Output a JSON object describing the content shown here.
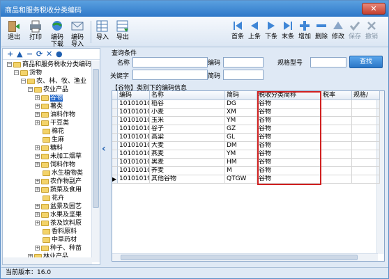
{
  "window": {
    "title": "商品和服务税收分类编码",
    "close": "✕"
  },
  "toolbar": {
    "exit": "退出",
    "print": "打印",
    "download": [
      "编码",
      "下载"
    ],
    "upload": [
      "编码",
      "导入"
    ],
    "import": "导入",
    "export": "导出",
    "first": "首条",
    "prev": "上条",
    "next": "下条",
    "last": "末条",
    "add": "增加",
    "delete": "删除",
    "edit": "修改",
    "save": "保存",
    "undo": "撤销"
  },
  "left_tools": [
    "+",
    "▲",
    "−",
    "⟳",
    "✕",
    "●"
  ],
  "tree": [
    {
      "label": "商品和服务税收分类编码",
      "indent": 0,
      "pm": "−"
    },
    {
      "label": "货物",
      "indent": 1,
      "pm": "−"
    },
    {
      "label": "农、林、牧、渔业",
      "indent": 2,
      "pm": "−"
    },
    {
      "label": "农业产品",
      "indent": 3,
      "pm": "−"
    },
    {
      "label": "谷物",
      "indent": 4,
      "pm": "+",
      "selected": true
    },
    {
      "label": "薯类",
      "indent": 4,
      "pm": "+"
    },
    {
      "label": "油料作物",
      "indent": 4,
      "pm": "+"
    },
    {
      "label": "干豆类",
      "indent": 4,
      "pm": "+"
    },
    {
      "label": "棉花",
      "indent": 4,
      "pm": ""
    },
    {
      "label": "生麻",
      "indent": 4,
      "pm": ""
    },
    {
      "label": "糖料",
      "indent": 4,
      "pm": "+"
    },
    {
      "label": "未加工烟草",
      "indent": 4,
      "pm": "+"
    },
    {
      "label": "饲料作物",
      "indent": 4,
      "pm": "+"
    },
    {
      "label": "水生植物类",
      "indent": 4,
      "pm": ""
    },
    {
      "label": "农作物副产",
      "indent": 4,
      "pm": "+"
    },
    {
      "label": "蔬菜及食用",
      "indent": 4,
      "pm": "+"
    },
    {
      "label": "花卉",
      "indent": 4,
      "pm": ""
    },
    {
      "label": "盆景及园艺",
      "indent": 4,
      "pm": "+"
    },
    {
      "label": "水果及坚果",
      "indent": 4,
      "pm": "+"
    },
    {
      "label": "茶及饮料原",
      "indent": 4,
      "pm": "+"
    },
    {
      "label": "香料原料",
      "indent": 4,
      "pm": ""
    },
    {
      "label": "中草药材",
      "indent": 4,
      "pm": ""
    },
    {
      "label": "种子、种苗",
      "indent": 4,
      "pm": "+"
    },
    {
      "label": "林业产品",
      "indent": 3,
      "pm": "+"
    }
  ],
  "query": {
    "title": "查询条件",
    "name_label": "名称",
    "code_label": "编码",
    "model_label": "规格型号",
    "keyword_label": "关键字",
    "short_code_label": "简码",
    "search": "查找"
  },
  "grid": {
    "title": "【谷物】类别下的编码信息",
    "headers": [
      "编码",
      "名称",
      "简码",
      "税收分类简称",
      "税率",
      "规格/"
    ],
    "rows": [
      [
        "1010101010(",
        "稻谷",
        "DG",
        "谷物"
      ],
      [
        "1010101020(",
        "小麦",
        "XM",
        "谷物"
      ],
      [
        "1010101030(",
        "玉米",
        "YM",
        "谷物"
      ],
      [
        "1010101040(",
        "谷子",
        "GZ",
        "谷物"
      ],
      [
        "1010101050(",
        "高粱",
        "GL",
        "谷物"
      ],
      [
        "1010101060(",
        "大麦",
        "DM",
        "谷物"
      ],
      [
        "1010101070(",
        "燕麦",
        "YM",
        "谷物"
      ],
      [
        "1010101080(",
        "黑麦",
        "HM",
        "谷物"
      ],
      [
        "1010101090(",
        "荞麦",
        "M",
        "谷物"
      ],
      [
        "1010101990(",
        "其他谷物",
        "QTGW",
        "谷物"
      ]
    ],
    "current_marker": "▶"
  },
  "status": {
    "version": "当前版本：16.0"
  },
  "colors": {
    "title": "#2f78c8",
    "accent": "#1e64c8",
    "highlight": "#d02020"
  }
}
